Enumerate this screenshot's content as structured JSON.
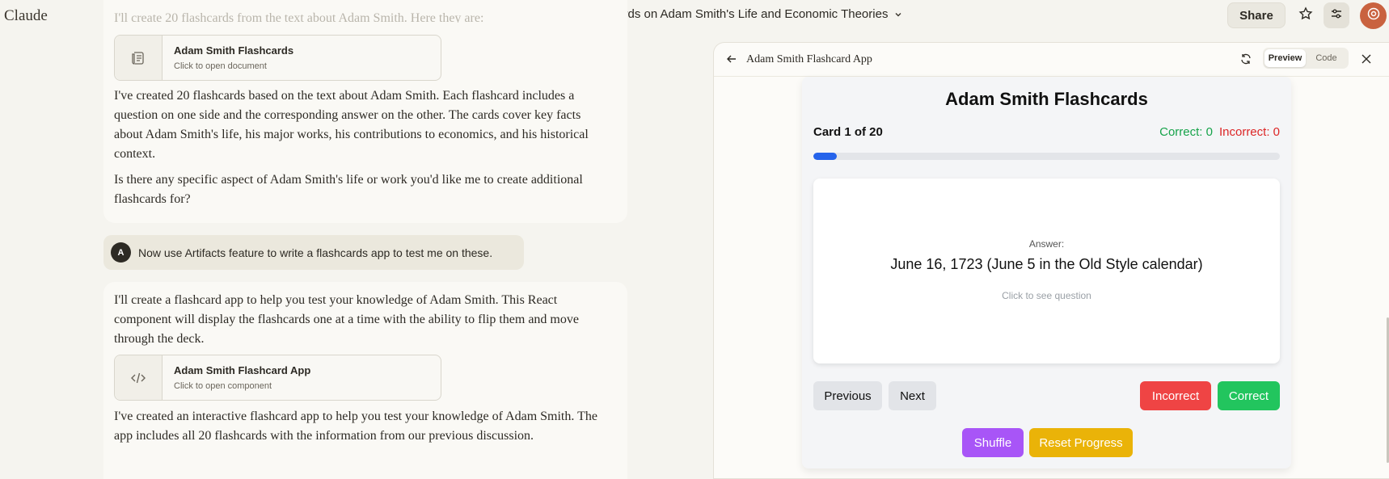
{
  "app": {
    "logo": "Claude"
  },
  "header": {
    "conversation_title": "Flashcards on Adam Smith's Life and Economic Theories",
    "share_label": "Share"
  },
  "chat": {
    "faded_line": "I'll create 20 flashcards from the text about Adam Smith. Here they are:",
    "artifact1": {
      "title": "Adam Smith Flashcards",
      "subtitle": "Click to open document",
      "icon": "document-icon"
    },
    "para1": "I've created 20 flashcards based on the text about Adam Smith. Each flashcard includes a question on one side and the corresponding answer on the other. The cards cover key facts about Adam Smith's life, his major works, his contributions to economics, and his historical context.",
    "para2": "Is there any specific aspect of Adam Smith's life or work you'd like me to create additional flashcards for?",
    "user_initial": "A",
    "user_message": "Now use Artifacts feature to write a flashcards app to test me on these.",
    "para3": "I'll create a flashcard app to help you test your knowledge of Adam Smith. This React component will display the flashcards one at a time with the ability to flip them and move through the deck.",
    "artifact2": {
      "title": "Adam Smith Flashcard App",
      "subtitle": "Click to open component",
      "icon": "code-icon"
    },
    "para4": "I've created an interactive flashcard app to help you test your knowledge of Adam Smith. The app includes all 20 flashcards with the information from our previous discussion."
  },
  "panel": {
    "title": "Adam Smith Flashcard App",
    "toggle": {
      "preview": "Preview",
      "code": "Code",
      "active": "preview"
    }
  },
  "flashcard_app": {
    "title": "Adam Smith Flashcards",
    "card_counter": "Card 1 of 20",
    "correct_text": "Correct: 0",
    "incorrect_text": "Incorrect: 0",
    "progress_fraction": 0.05,
    "card": {
      "label": "Answer:",
      "answer": "June 16, 1723 (June 5 in the Old Style calendar)",
      "hint": "Click to see question"
    },
    "buttons": {
      "previous": "Previous",
      "next": "Next",
      "incorrect": "Incorrect",
      "correct": "Correct",
      "shuffle": "Shuffle",
      "reset": "Reset Progress"
    }
  },
  "colors": {
    "accent_blue": "#2563eb",
    "correct_green": "#22c55e",
    "incorrect_red": "#ef4444",
    "shuffle_purple": "#a855f7",
    "reset_yellow": "#eab308",
    "avatar_orange": "#c9623f"
  }
}
